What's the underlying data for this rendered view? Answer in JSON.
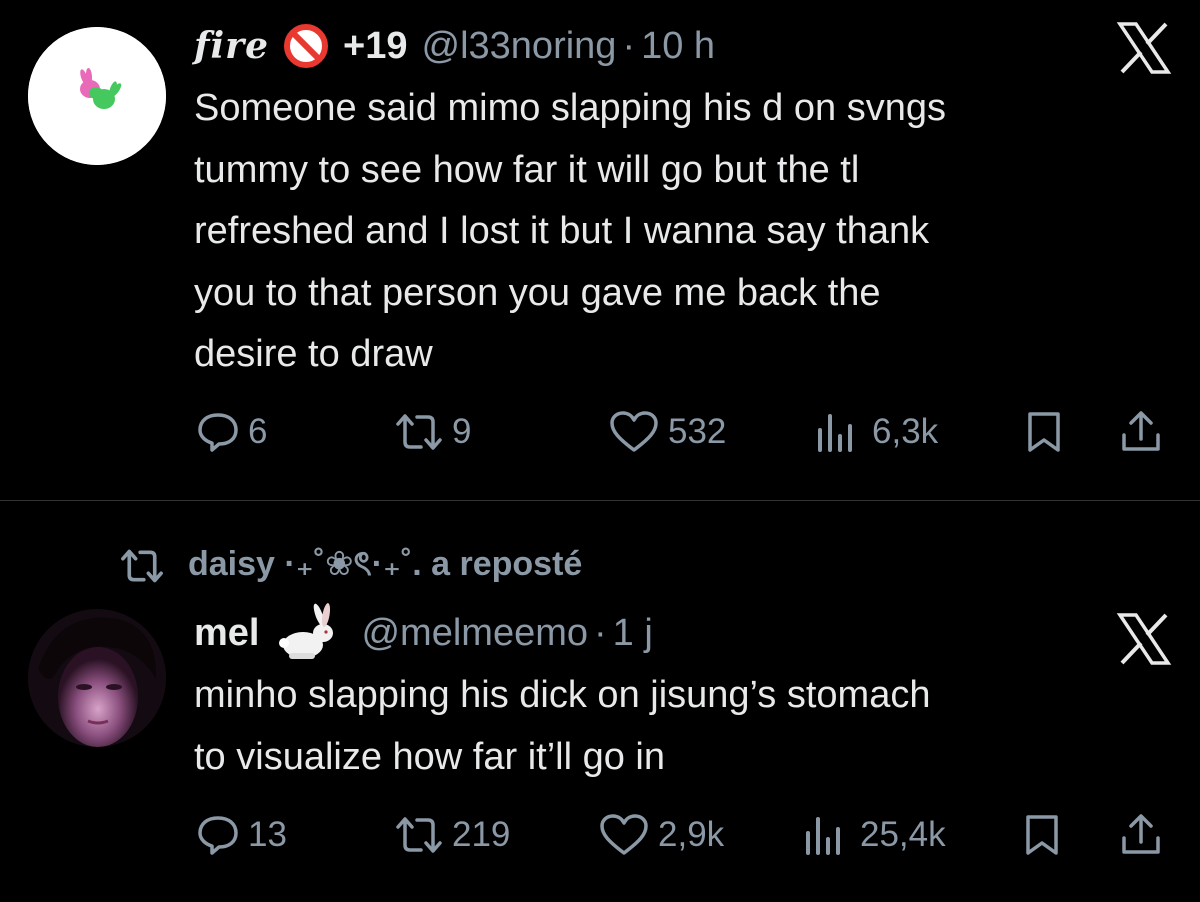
{
  "tweets": [
    {
      "display_name": "fire",
      "badge": "+19",
      "handle": "@l33noring",
      "separator": "·",
      "time": "10 h",
      "text": "Someone said mimo slapping his d on svngs\ntummy to see how far it will go but the tl\nrefreshed and I lost it but I wanna say thank\nyou to that person you gave me back the\ndesire to draw",
      "stats": {
        "replies": "6",
        "reposts": "9",
        "likes": "532",
        "views": "6,3k"
      }
    },
    {
      "repost_by": "daisy ·₊˚❀ৎ·₊˚. a reposté",
      "display_name": "mel",
      "handle": "@melmeemo",
      "separator": "·",
      "time": "1 j",
      "text": "minho slapping his dick on jisung’s stomach\nto visualize how far it’ll go in",
      "stats": {
        "replies": "13",
        "reposts": "219",
        "likes": "2,9k",
        "views": "25,4k"
      }
    }
  ],
  "icons": {
    "reply": "reply-icon",
    "repost": "repost-icon",
    "like": "heart-icon",
    "views": "views-icon",
    "bookmark": "bookmark-icon",
    "share": "share-icon",
    "logo": "x-logo-icon",
    "prohibited": "prohibited-icon",
    "rabbit": "rabbit-icon"
  },
  "colors": {
    "background": "#000000",
    "text": "#e7e9ea",
    "muted": "#8b98a5",
    "divider": "#2f3336",
    "prohibited": "#e8382f"
  }
}
